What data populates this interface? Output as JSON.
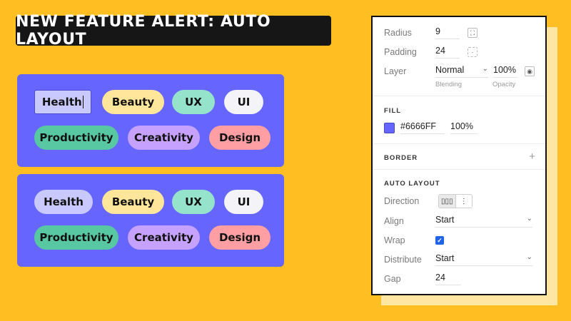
{
  "banner": {
    "title": "NEW FEATURE ALERT: AUTO LAYOUT"
  },
  "cards": [
    {
      "chips": [
        {
          "label": "Health",
          "color": "#C9C9FF"
        },
        {
          "label": "Beauty",
          "color": "#FFE69A"
        },
        {
          "label": "UX",
          "color": "#96E3CB"
        },
        {
          "label": "UI",
          "color": "#F3F3F8"
        },
        {
          "label": "Productivity",
          "color": "#58C8A2"
        },
        {
          "label": "Creativity",
          "color": "#C6A1FF"
        },
        {
          "label": "Design",
          "color": "#FF9FA3"
        }
      ]
    },
    {
      "chips": [
        {
          "label": "Health",
          "color": "#C9C9FF"
        },
        {
          "label": "Beauty",
          "color": "#FFE69A"
        },
        {
          "label": "UX",
          "color": "#96E3CB"
        },
        {
          "label": "UI",
          "color": "#F3F3F8"
        },
        {
          "label": "Productivity",
          "color": "#58C8A2"
        },
        {
          "label": "Creativity",
          "color": "#C6A1FF"
        },
        {
          "label": "Design",
          "color": "#FF9FA3"
        }
      ]
    }
  ],
  "panel": {
    "radius": {
      "label": "Radius",
      "value": "9",
      "icon": "corner-radius-icon"
    },
    "padding": {
      "label": "Padding",
      "value": "24",
      "icon": "padding-icon"
    },
    "layer": {
      "label": "Layer",
      "blending": "Normal",
      "opacity": "100%",
      "blending_caption": "Blending",
      "opacity_caption": "Opacity",
      "icon": "eye-icon"
    },
    "fill": {
      "heading": "FILL",
      "hex": "#6666FF",
      "opacity": "100%",
      "swatch_color": "#6666FF"
    },
    "border": {
      "heading": "BORDER",
      "add_symbol": "+"
    },
    "auto_layout": {
      "heading": "AUTO LAYOUT",
      "direction": {
        "label": "Direction",
        "options": [
          "horizontal-icon",
          "vertical-icon"
        ]
      },
      "align": {
        "label": "Align",
        "value": "Start"
      },
      "wrap": {
        "label": "Wrap",
        "checked": true
      },
      "distribute": {
        "label": "Distribute",
        "value": "Start"
      },
      "gap": {
        "label": "Gap",
        "value": "24"
      }
    }
  }
}
